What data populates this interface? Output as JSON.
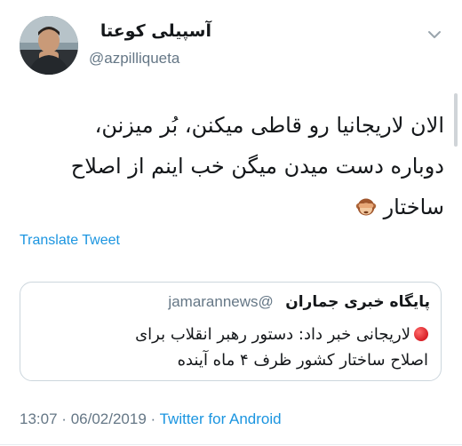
{
  "author": {
    "display_name": "آسپیلی کوعتا",
    "handle": "@azpilliqueta"
  },
  "tweet": {
    "lines": [
      "الان لاریجانیا رو قاطی میکنن، بُر میزنن،",
      "دوباره دست میدن میگن خب اینم از اصلاح",
      "ساختار"
    ],
    "emoji_icon": "see-no-evil-monkey-icon",
    "translate_label": "Translate Tweet"
  },
  "quoted": {
    "display_name": "پایگاه خبری جماران",
    "handle": "@jamarannews",
    "lines": [
      "لاریجانی خبر داد: دستور رهبر انقلاب برای",
      "اصلاح ساختار کشور ظرف ۴ ماه آینده"
    ],
    "bullet_icon": "red-circle-icon"
  },
  "meta": {
    "time": "13:07",
    "separator": "·",
    "date": "06/02/2019",
    "source": "Twitter for Android"
  },
  "colors": {
    "link": "#1b95e0",
    "secondary": "#657786",
    "border": "#ccd6dd"
  }
}
